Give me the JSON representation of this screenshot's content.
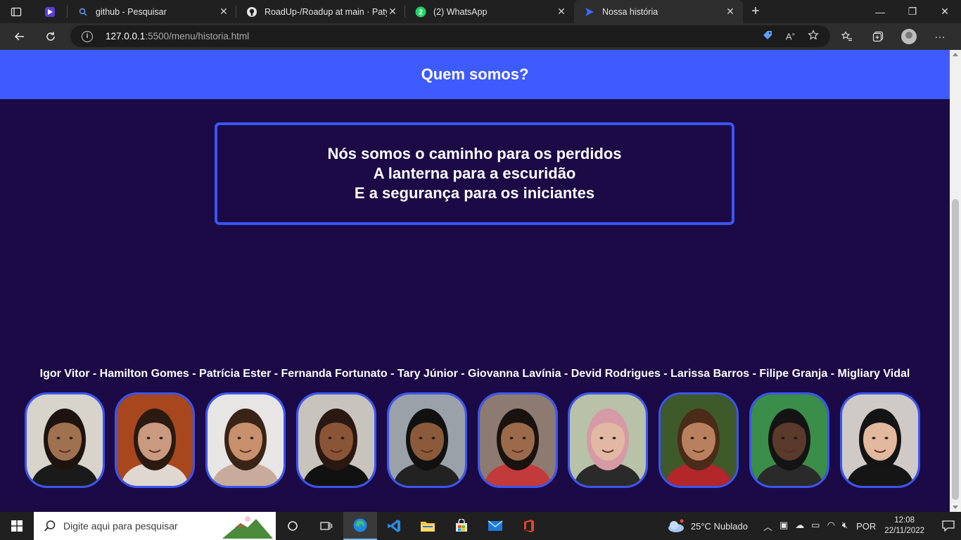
{
  "browser": {
    "tabs": [
      {
        "title": "github - Pesquisar",
        "icon": "search-icon"
      },
      {
        "title": "RoadUp-/Roadup at main · Patyh",
        "icon": "github-icon"
      },
      {
        "title": "(2) WhatsApp",
        "icon": "whatsapp-icon",
        "badge": "2"
      },
      {
        "title": "Nossa história",
        "icon": "play-logo-icon",
        "active": true
      }
    ],
    "url": {
      "host": "127.0.0.1",
      "path": ":5500/menu/historia.html"
    }
  },
  "page": {
    "header_title": "Quem somos?",
    "motto": [
      "Nós somos o caminho para os perdidos",
      "A lanterna para a escuridão",
      "E a segurança para os iniciantes"
    ],
    "members_line": "Igor Vitor - Hamilton Gomes - Patrícia Ester - Fernanda Fortunato - Tary Júnior - Giovanna Lavínia - Devid Rodrigues - Larissa Barros - Filipe Granja - Migliary Vidal",
    "photos": [
      {
        "name": "Igor Vitor",
        "bg": "#d8d4cc",
        "skin": "#a0714f",
        "hair": "#1d1410",
        "shirt": "#1a1a1a"
      },
      {
        "name": "Hamilton Gomes",
        "bg": "#a8471e",
        "skin": "#c99a7f",
        "hair": "#2a1a10",
        "shirt": "#e0d8d0"
      },
      {
        "name": "Patrícia Ester",
        "bg": "#e8e6e4",
        "skin": "#c8906c",
        "hair": "#3a2418",
        "shirt": "#c9ab9c"
      },
      {
        "name": "Fernanda Fortunato",
        "bg": "#c9c3bd",
        "skin": "#8a5436",
        "hair": "#2a1812",
        "shirt": "#111111"
      },
      {
        "name": "Tary Júnior",
        "bg": "#9aa1a8",
        "skin": "#8a5a3a",
        "hair": "#111111",
        "shirt": "#222222"
      },
      {
        "name": "Giovanna Lavínia",
        "bg": "#8d7a70",
        "skin": "#9a6a4a",
        "hair": "#1a120e",
        "shirt": "#c23a3a"
      },
      {
        "name": "Devid Rodrigues",
        "bg": "#b7c2a8",
        "skin": "#e1b8a3",
        "hair": "#d69aa6",
        "shirt": "#2a2a2a"
      },
      {
        "name": "Larissa Barros",
        "bg": "#3e5a2a",
        "skin": "#b98060",
        "hair": "#4a2c18",
        "shirt": "#b3262a"
      },
      {
        "name": "Filipe Granja",
        "bg": "#3a8e4a",
        "skin": "#5a3a2a",
        "hair": "#141414",
        "shirt": "#2a2a2a"
      },
      {
        "name": "Migliary Vidal",
        "bg": "#cfcac6",
        "skin": "#e2b89e",
        "hair": "#141414",
        "shirt": "#151515"
      }
    ],
    "colors": {
      "background": "#1b0a45",
      "header": "#3e5bff",
      "border": "#3b55f5"
    }
  },
  "taskbar": {
    "search_placeholder": "Digite aqui para pesquisar",
    "weather": "25°C  Nublado",
    "language": "POR",
    "time": "12:08",
    "date": "22/11/2022"
  }
}
